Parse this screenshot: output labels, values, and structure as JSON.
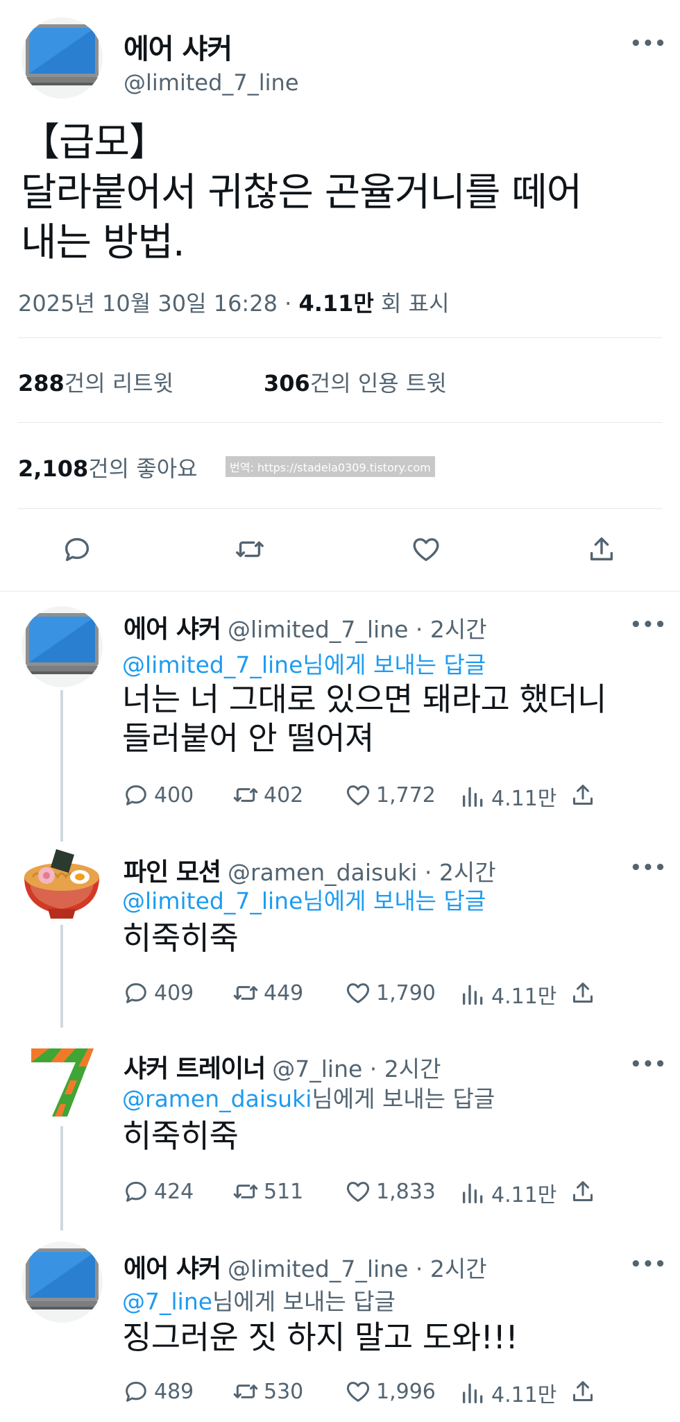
{
  "main_tweet": {
    "author_name": "에어 샤커",
    "author_handle": "@limited_7_line",
    "more_label": "•••",
    "body_lines": [
      "【급모】",
      "달라붙어서 귀찮은 곤율거니를 떼어",
      "내는 방법."
    ],
    "timestamp": "2025년 10월 30일  16:28 ·",
    "views_count": "4.11만",
    "views_label": "회 표시",
    "retweets_count": "288",
    "retweets_label": "건의 리트윗",
    "quotes_count": "306",
    "quotes_label": "건의 인용 트윗",
    "likes_count": "2,108",
    "likes_label": "건의 좋아요",
    "watermark": "번역: https://stadela0309.tistory.com",
    "actions": [
      "reply-icon",
      "retweet-icon",
      "heart-icon",
      "share-icon"
    ]
  },
  "replies": [
    {
      "name": "에어 샤커",
      "handle": "@limited_7_line · 2시간",
      "to_link": "@limited_7_line",
      "to_suffix": "님에게 보내는 답글",
      "text_lines": [
        "너는 너 그대로 있으면 돼라고 했더니",
        "들러붙어 안 떨어져"
      ],
      "replies": "400",
      "retweets": "402",
      "likes": "1,772",
      "views": "4.11만",
      "avatar": "laptop-avatar"
    },
    {
      "name": "파인 모션",
      "handle": "@ramen_daisuki · 2시간",
      "to_link": "@limited_7_line",
      "to_suffix": "님에게 보내는 답글",
      "text_lines": [
        "히죽히죽"
      ],
      "replies": "409",
      "retweets": "449",
      "likes": "1,790",
      "views": "4.11만",
      "avatar": "ramen-avatar"
    },
    {
      "name": "샤커 트레이너",
      "handle": "@7_line · 2시간",
      "to_link": "@ramen_daisuki",
      "to_suffix": "님에게 보내는 답글",
      "text_lines": [
        "히죽히죽"
      ],
      "replies": "424",
      "retweets": "511",
      "likes": "1,833",
      "views": "4.11만",
      "avatar": "seven-avatar"
    },
    {
      "name": "에어 샤커",
      "handle": "@limited_7_line · 2시간",
      "to_link": "@7_line",
      "to_suffix": "님에게 보내는 답글",
      "text_lines": [
        "징그러운 짓 하지 말고 도와!!!"
      ],
      "replies": "489",
      "retweets": "530",
      "likes": "1,996",
      "views": "4.11만",
      "avatar": "laptop-avatar"
    }
  ],
  "colors": {
    "link": "#1d9bf0",
    "secondary": "#536471",
    "primary": "#0f1419",
    "thread_line": "#cfd9de"
  }
}
